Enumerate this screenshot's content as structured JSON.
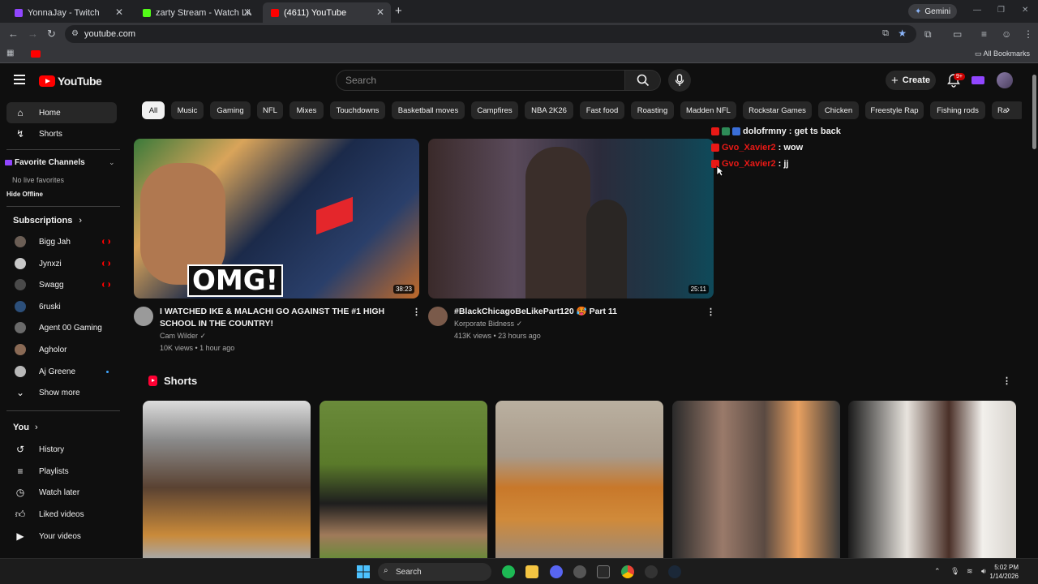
{
  "browser": {
    "tabs": [
      {
        "label": "YonnaJay - Twitch",
        "active": false
      },
      {
        "label": "zarty Stream - Watch Live on Ki",
        "active": false
      },
      {
        "label": "(4611) YouTube",
        "active": true
      }
    ],
    "new_tab": "+",
    "gemini_label": "Gemini",
    "url": "youtube.com",
    "all_bookmarks": "All Bookmarks"
  },
  "header": {
    "logo_text": "YouTube",
    "search_placeholder": "Search",
    "create_label": "Create",
    "notification_count": "9+"
  },
  "sidebar": {
    "main": [
      {
        "label": "Home",
        "icon": "home-icon",
        "active": true
      },
      {
        "label": "Shorts",
        "icon": "shorts-icon",
        "active": false
      }
    ],
    "favorite_channels": {
      "title": "Favorite Channels",
      "empty_text": "No live favorites",
      "hide_offline": "Hide Offline"
    },
    "subscriptions_title": "Subscriptions",
    "subscriptions": [
      {
        "label": "Bigg Jah",
        "indicator": "live",
        "color": "#6b5e55"
      },
      {
        "label": "Jynxzi",
        "indicator": "live",
        "color": "#c9c9c9"
      },
      {
        "label": "Swagg",
        "indicator": "live",
        "color": "#4a4a4a"
      },
      {
        "label": "6ruski",
        "indicator": "none",
        "color": "#2c4f7a"
      },
      {
        "label": "Agent 00 Gaming",
        "indicator": "none",
        "color": "#6a6a6a"
      },
      {
        "label": "Agholor",
        "indicator": "none",
        "color": "#8a6a55"
      },
      {
        "label": "Aj Greene",
        "indicator": "new",
        "color": "#b8b8b8"
      }
    ],
    "show_more": "Show more",
    "you_title": "You",
    "you_items": [
      {
        "label": "History",
        "icon": "history-icon"
      },
      {
        "label": "Playlists",
        "icon": "playlists-icon"
      },
      {
        "label": "Watch later",
        "icon": "watch-later-icon"
      },
      {
        "label": "Liked videos",
        "icon": "liked-videos-icon"
      },
      {
        "label": "Your videos",
        "icon": "your-videos-icon"
      }
    ]
  },
  "chips": [
    "All",
    "Music",
    "Gaming",
    "NFL",
    "Mixes",
    "Touchdowns",
    "Basketball moves",
    "Campfires",
    "NBA 2K26",
    "Fast food",
    "Roasting",
    "Madden NFL",
    "Rockstar Games",
    "Chicken",
    "Freestyle Rap",
    "Fishing rods",
    "Ra"
  ],
  "videos": [
    {
      "title_line1": "I WATCHED IKE & MALACHI GO AGAINST THE #1 HIGH",
      "title_line2": "SCHOOL IN THE COUNTRY!",
      "channel": "Cam Wilder",
      "meta": "10K views • 1 hour ago",
      "duration": "38:23",
      "thumb_text": "OMG!"
    },
    {
      "title_line1": "#BlackChicagoBeLikePart120 🥵 Part 11",
      "title_line2": "",
      "channel": "Korporate Bidness",
      "meta": "413K views • 23 hours ago",
      "duration": "25:11",
      "thumb_text": ""
    }
  ],
  "chat": [
    {
      "user": "dolofrmny",
      "message": "get ts back",
      "user_color": "#f1f1f1"
    },
    {
      "user": "Gvo_Xavier2",
      "message": "wow",
      "user_color": "#e91916"
    },
    {
      "user": "Gvo_Xavier2",
      "message": "jj",
      "user_color": "#e91916"
    }
  ],
  "shorts_title": "Shorts",
  "taskbar": {
    "search_label": "Search",
    "time": "5:02 PM",
    "date": "1/14/2026"
  },
  "colors": {
    "background": "#0f0f0f",
    "accent": "#ff0000",
    "chip_bg": "#272727"
  }
}
